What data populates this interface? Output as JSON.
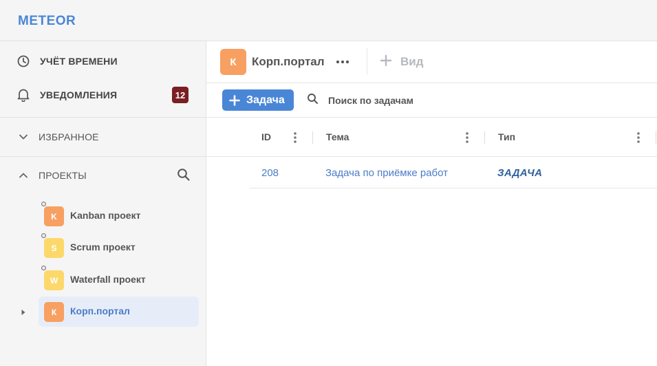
{
  "app": {
    "logo": "METEOR",
    "accent": "#4a86d6"
  },
  "sidebar": {
    "nav": [
      {
        "label": "УЧЁТ ВРЕМЕНИ",
        "icon": "clock-icon"
      },
      {
        "label": "УВЕДОМЛЕНИЯ",
        "icon": "bell-icon",
        "badge": "12"
      }
    ],
    "favorites": {
      "label": "ИЗБРАННОЕ",
      "state": "collapsed"
    },
    "projects": {
      "label": "ПРОЕКТЫ",
      "state": "expanded",
      "items": [
        {
          "label": "Kanban проект",
          "avatar": "K",
          "color": "#f7a062"
        },
        {
          "label": "Scrum проект",
          "avatar": "S",
          "color": "#fcd86a"
        },
        {
          "label": "Waterfall проект",
          "avatar": "W",
          "color": "#fcd86a"
        },
        {
          "label": "Корп.портал",
          "avatar": "К",
          "color": "#f7a062",
          "active": true
        }
      ]
    }
  },
  "header": {
    "avatar": "К",
    "title": "Корп.портал",
    "add_view_label": "Вид"
  },
  "toolbar": {
    "new_task_label": "Задача",
    "search_placeholder": "Поиск по задачам"
  },
  "table": {
    "columns": [
      "ID",
      "Тема",
      "Тип"
    ],
    "rows": [
      {
        "id": "208",
        "subject": "Задача по приёмке работ",
        "type": "ЗАДАЧА"
      }
    ]
  }
}
